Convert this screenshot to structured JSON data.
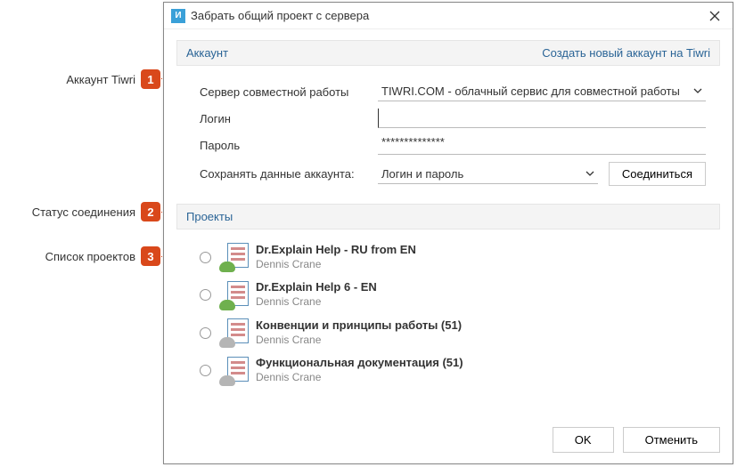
{
  "callouts": {
    "c1": "Аккаунт Tiwri",
    "c2": "Статус соединения",
    "c3": "Список проектов",
    "n1": "1",
    "n2": "2",
    "n3": "3"
  },
  "dialog": {
    "title": "Забрать общий проект с сервера",
    "icon_letter": "И"
  },
  "account": {
    "header": "Аккаунт",
    "create_link": "Создать новый аккаунт на Tiwri",
    "server_label": "Сервер совместной работы",
    "server_value": "TIWRI.COM - облачный сервис для совместной работы",
    "login_label": "Логин",
    "login_value": "",
    "password_label": "Пароль",
    "password_value": "**************",
    "save_label": "Сохранять данные аккаунта:",
    "save_value": "Логин и пароль",
    "connect": "Соединиться"
  },
  "projects": {
    "header": "Проекты",
    "items": [
      {
        "title": "Dr.Explain Help - RU from EN",
        "author": "Dennis Crane",
        "cloud": "green"
      },
      {
        "title": "Dr.Explain Help 6 - EN",
        "author": "Dennis Crane",
        "cloud": "green"
      },
      {
        "title": "Конвенции и принципы работы (51)",
        "author": "Dennis Crane",
        "cloud": "grey"
      },
      {
        "title": "Функциональная документация (51)",
        "author": "Dennis Crane",
        "cloud": "grey"
      }
    ]
  },
  "footer": {
    "ok": "OK",
    "cancel": "Отменить"
  }
}
